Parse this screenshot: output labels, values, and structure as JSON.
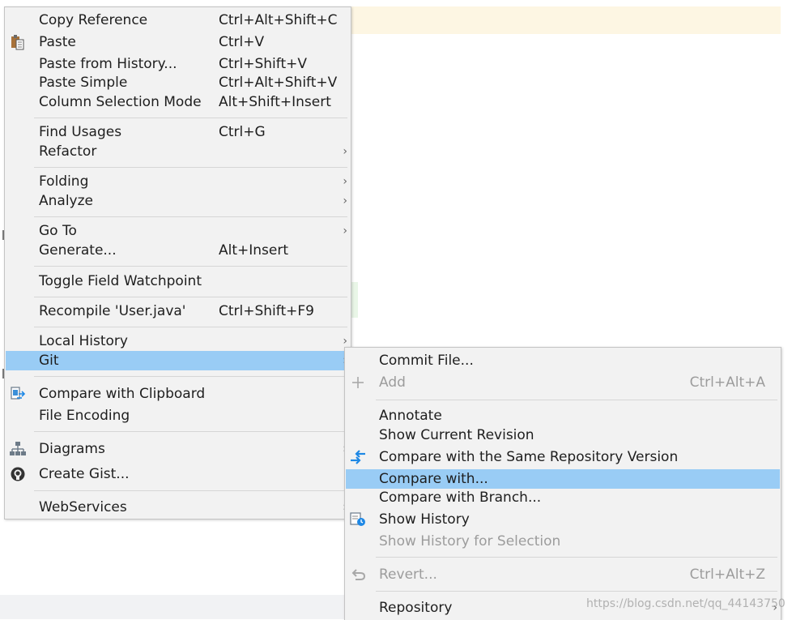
{
  "main_menu": {
    "items": [
      {
        "label": "Copy Reference",
        "shortcut": "Ctrl+Alt+Shift+C"
      },
      {
        "label": "Paste",
        "shortcut": "Ctrl+V",
        "icon": "clipboard-paste-icon"
      },
      {
        "label": "Paste from History...",
        "shortcut": "Ctrl+Shift+V"
      },
      {
        "label": "Paste Simple",
        "shortcut": "Ctrl+Alt+Shift+V"
      },
      {
        "label": "Column Selection Mode",
        "shortcut": "Alt+Shift+Insert"
      },
      {
        "label": "Find Usages",
        "shortcut": "Ctrl+G"
      },
      {
        "label": "Refactor",
        "submenu_arrow": "›"
      },
      {
        "label": "Folding",
        "submenu_arrow": "›"
      },
      {
        "label": "Analyze",
        "submenu_arrow": "›"
      },
      {
        "label": "Go To",
        "submenu_arrow": "›"
      },
      {
        "label": "Generate...",
        "shortcut": "Alt+Insert"
      },
      {
        "label": "Toggle Field Watchpoint"
      },
      {
        "label": "Recompile 'User.java'",
        "shortcut": "Ctrl+Shift+F9"
      },
      {
        "label": "Local History",
        "submenu_arrow": "›"
      },
      {
        "label": "Git",
        "submenu_arrow": "›",
        "highlighted": true
      },
      {
        "label": "Compare with Clipboard",
        "icon": "compare-clipboard-icon"
      },
      {
        "label": "File Encoding"
      },
      {
        "label": "Diagrams",
        "submenu_arrow": "›",
        "icon": "diagrams-icon"
      },
      {
        "label": "Create Gist...",
        "icon": "github-icon"
      },
      {
        "label": "WebServices",
        "submenu_arrow": "›"
      }
    ]
  },
  "git_submenu": {
    "items": [
      {
        "label": "Commit File..."
      },
      {
        "label": "Add",
        "shortcut": "Ctrl+Alt+A",
        "disabled": true,
        "icon": "plus-icon"
      },
      {
        "label": "Annotate"
      },
      {
        "label": "Show Current Revision"
      },
      {
        "label": "Compare with the Same Repository Version",
        "icon": "compare-arrows-icon"
      },
      {
        "label": "Compare with...",
        "highlighted": true
      },
      {
        "label": "Compare with Branch..."
      },
      {
        "label": "Show History",
        "icon": "show-history-icon"
      },
      {
        "label": "Show History for Selection",
        "disabled": true
      },
      {
        "label": "Revert...",
        "shortcut": "Ctrl+Alt+Z",
        "disabled": true,
        "icon": "revert-icon"
      },
      {
        "label": "Repository",
        "submenu_arrow": "›"
      }
    ]
  },
  "watermark": "https://blog.csdn.net/qq_44143750",
  "colors": {
    "menu_background": "#f2f2f2",
    "highlight": "#99ccf5",
    "separator": "#d6d6d6",
    "disabled_text": "#9c9c9c",
    "accent_blue": "#1e88e5"
  }
}
